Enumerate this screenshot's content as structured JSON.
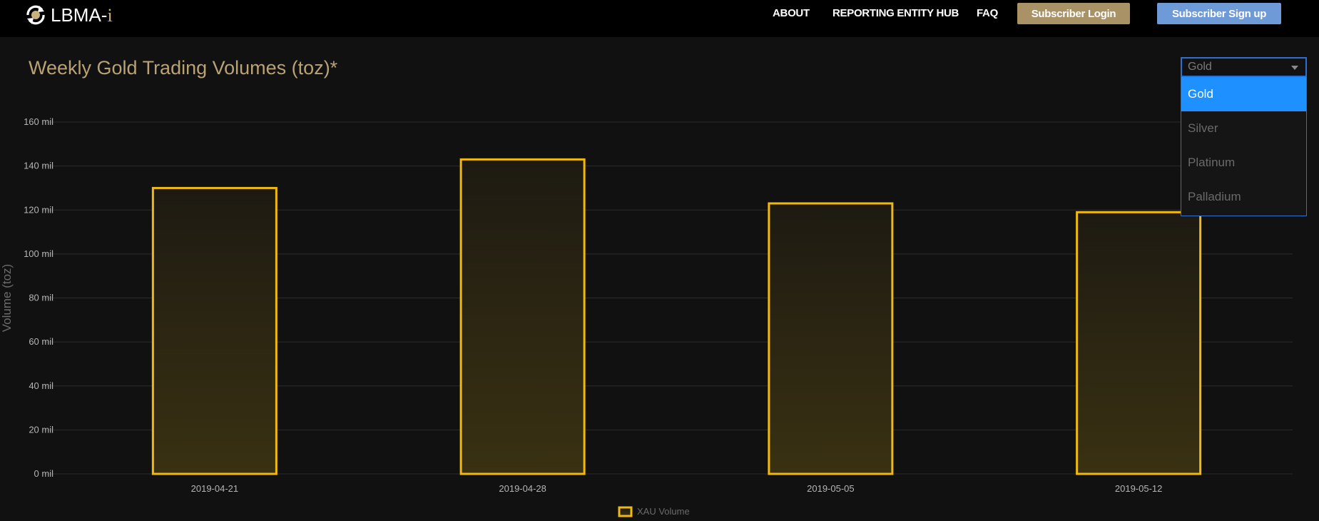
{
  "header": {
    "logo_text": "LBMA-",
    "logo_suffix": "i",
    "nav": [
      "ABOUT",
      "REPORTING ENTITY HUB",
      "FAQ"
    ],
    "login_label": "Subscriber Login",
    "signup_label": "Subscriber Sign up"
  },
  "page": {
    "title": "Weekly Gold Trading Volumes (toz)*"
  },
  "metal_select": {
    "value": "Gold",
    "options": [
      "Gold",
      "Silver",
      "Platinum",
      "Palladium"
    ],
    "active_index": 0
  },
  "colors": {
    "brand_gold": "#b9a273",
    "login_button": "#a99266",
    "signup_button": "#6f9ad8",
    "bar_stroke": "#f0b90f",
    "select_highlight": "#1e90ff"
  },
  "chart_data": {
    "type": "bar",
    "categories": [
      "2019-04-21",
      "2019-04-28",
      "2019-05-05",
      "2019-05-12"
    ],
    "series": [
      {
        "name": "XAU Volume",
        "values": [
          130,
          143,
          123,
          119
        ]
      }
    ],
    "ylabel": "Volume (toz)",
    "ylim": [
      0,
      160
    ],
    "yticks": [
      0,
      20,
      40,
      60,
      80,
      100,
      120,
      140,
      160
    ],
    "ytick_labels": [
      "0 mil",
      "20 mil",
      "40 mil",
      "60 mil",
      "80 mil",
      "100 mil",
      "120 mil",
      "140 mil",
      "160 mil"
    ],
    "grid": true,
    "legend_position": "bottom-center"
  }
}
